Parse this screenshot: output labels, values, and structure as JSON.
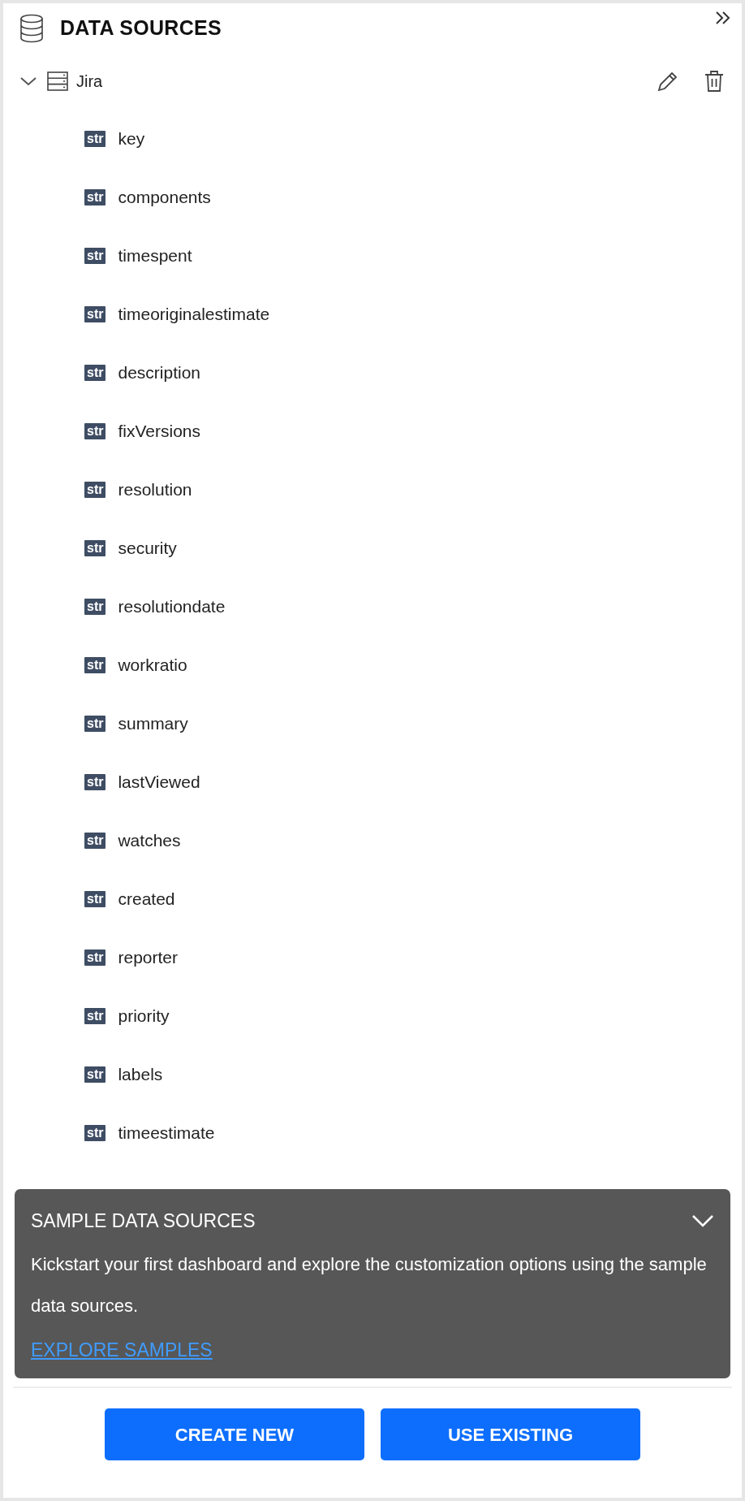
{
  "header": {
    "title": "DATA SOURCES"
  },
  "source": {
    "name": "Jira",
    "expanded": true,
    "fields": [
      {
        "type": "str",
        "name": "key"
      },
      {
        "type": "str",
        "name": "components"
      },
      {
        "type": "str",
        "name": "timespent"
      },
      {
        "type": "str",
        "name": "timeoriginalestimate"
      },
      {
        "type": "str",
        "name": "description"
      },
      {
        "type": "str",
        "name": "fixVersions"
      },
      {
        "type": "str",
        "name": "resolution"
      },
      {
        "type": "str",
        "name": "security"
      },
      {
        "type": "str",
        "name": "resolutiondate"
      },
      {
        "type": "str",
        "name": "workratio"
      },
      {
        "type": "str",
        "name": "summary"
      },
      {
        "type": "str",
        "name": "lastViewed"
      },
      {
        "type": "str",
        "name": "watches"
      },
      {
        "type": "str",
        "name": "created"
      },
      {
        "type": "str",
        "name": "reporter"
      },
      {
        "type": "str",
        "name": "priority"
      },
      {
        "type": "str",
        "name": "labels"
      },
      {
        "type": "str",
        "name": "timeestimate"
      }
    ]
  },
  "sample_panel": {
    "title": "SAMPLE DATA SOURCES",
    "expanded": true,
    "text": "Kickstart your first dashboard and explore the customization options using the sample data sources.",
    "link": "EXPLORE SAMPLES"
  },
  "buttons": [
    "CREATE NEW",
    "USE EXISTING"
  ]
}
